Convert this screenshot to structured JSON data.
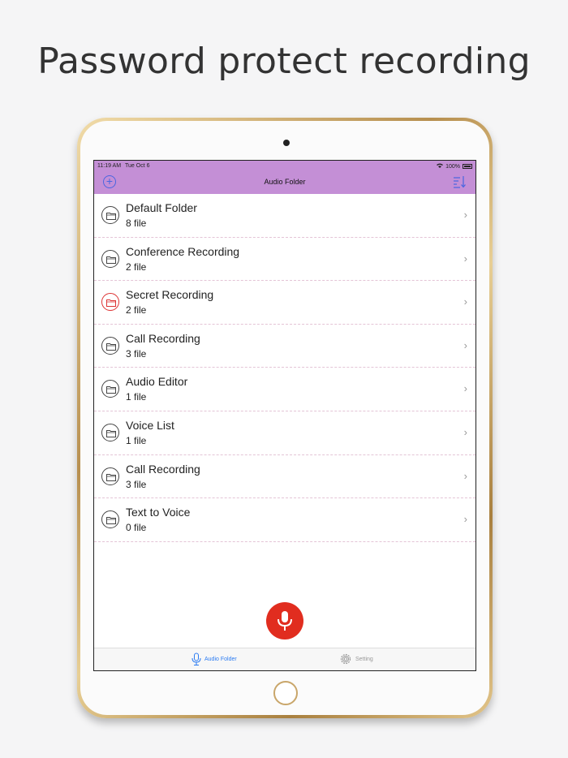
{
  "headline": "Password protect recording",
  "status": {
    "time": "11:19 AM",
    "date": "Tue Oct 6",
    "battery": "100%"
  },
  "nav": {
    "title": "Audio Folder"
  },
  "folders": [
    {
      "name": "Default Folder",
      "count": "8 file",
      "icon": "folder-icon",
      "color": "#444444"
    },
    {
      "name": "Conference Recording",
      "count": "2 file",
      "icon": "folder-icon",
      "color": "#444444"
    },
    {
      "name": "Secret Recording",
      "count": "2 file",
      "icon": "folder-icon",
      "color": "#dd3333"
    },
    {
      "name": "Call Recording",
      "count": "3 file",
      "icon": "folder-icon",
      "color": "#444444"
    },
    {
      "name": "Audio Editor",
      "count": "1 file",
      "icon": "folder-icon",
      "color": "#444444"
    },
    {
      "name": "Voice List",
      "count": "1 file",
      "icon": "folder-icon",
      "color": "#444444"
    },
    {
      "name": "Call Recording",
      "count": "3 file",
      "icon": "folder-icon",
      "color": "#444444"
    },
    {
      "name": "Text to Voice",
      "count": "0 file",
      "icon": "folder-icon",
      "color": "#444444"
    }
  ],
  "tabs": {
    "audio_folder": "Audio Folder",
    "setting": "Setting"
  },
  "colors": {
    "nav_bg": "#c48fd6",
    "accent": "#2b7bf2",
    "record": "#e12d1f"
  }
}
